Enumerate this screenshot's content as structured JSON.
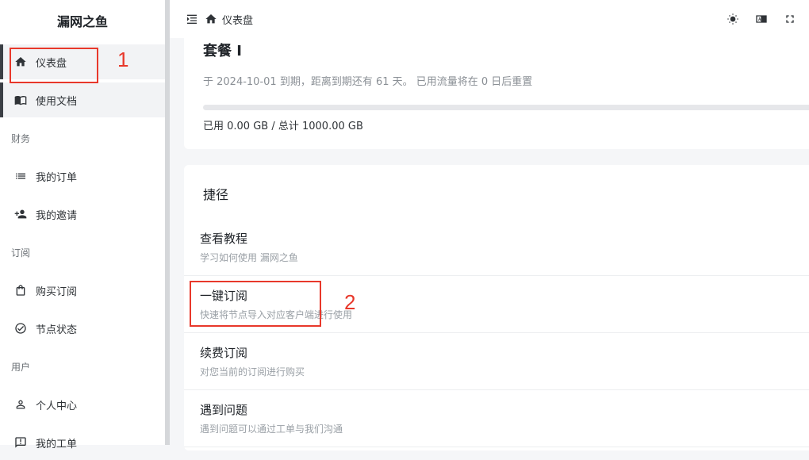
{
  "sidebar": {
    "brand": "漏网之鱼",
    "items": [
      {
        "label": "仪表盘",
        "icon": "home-icon"
      },
      {
        "label": "使用文档",
        "icon": "book-icon"
      },
      {
        "group": "财务"
      },
      {
        "label": "我的订单",
        "icon": "list-icon"
      },
      {
        "label": "我的邀请",
        "icon": "user-add-icon"
      },
      {
        "group": "订阅"
      },
      {
        "label": "购买订阅",
        "icon": "bag-icon"
      },
      {
        "label": "节点状态",
        "icon": "check-circle-icon"
      },
      {
        "group": "用户"
      },
      {
        "label": "个人中心",
        "icon": "person-icon"
      },
      {
        "label": "我的工单",
        "icon": "ticket-icon"
      }
    ]
  },
  "topbar": {
    "breadcrumb": "仪表盘"
  },
  "plan": {
    "title": "套餐 I",
    "expire_text": "于 2024-10-01 到期，距离到期还有 61 天。 已用流量将在 0 日后重置",
    "usage_text": "已用 0.00 GB / 总计 1000.00 GB",
    "used_fraction": 0.0
  },
  "shortcuts": {
    "title": "捷径",
    "items": [
      {
        "title": "查看教程",
        "desc": "学习如何使用 漏网之鱼"
      },
      {
        "title": "一键订阅",
        "desc": "快速将节点导入对应客户端进行使用"
      },
      {
        "title": "续费订阅",
        "desc": "对您当前的订阅进行购买"
      },
      {
        "title": "遇到问题",
        "desc": "遇到问题可以通过工单与我们沟通"
      }
    ]
  },
  "annotations": {
    "one": "1",
    "two": "2",
    "color": "#e8382b"
  }
}
